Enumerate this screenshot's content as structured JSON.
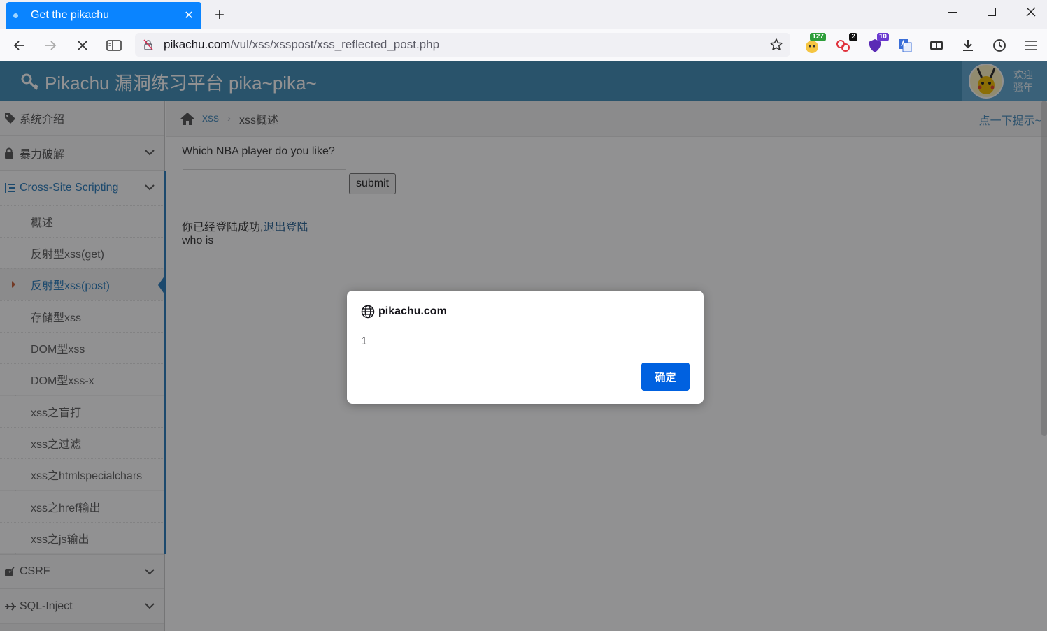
{
  "browser": {
    "tab_title": "Get the pikachu",
    "tab_close": "✕",
    "new_tab": "+",
    "url_host": "pikachu.com",
    "url_path": "/vul/xss/xsspost/xss_reflected_post.php",
    "extension_badges": [
      "127",
      "2",
      "10"
    ]
  },
  "site": {
    "brand": "Pikachu 漏洞练习平台 pika~pika~",
    "welcome_line1": "欢迎",
    "welcome_line2": "骚年"
  },
  "sidebar": {
    "top_items": [
      {
        "label": "系统介绍"
      },
      {
        "label": "暴力破解"
      },
      {
        "label": "Cross-Site Scripting"
      }
    ],
    "sub_items": [
      {
        "label": "概述"
      },
      {
        "label": "反射型xss(get)"
      },
      {
        "label": "反射型xss(post)"
      },
      {
        "label": "存储型xss"
      },
      {
        "label": "DOM型xss"
      },
      {
        "label": "DOM型xss-x"
      },
      {
        "label": "xss之盲打"
      },
      {
        "label": "xss之过滤"
      },
      {
        "label": "xss之htmlspecialchars"
      },
      {
        "label": "xss之href输出"
      },
      {
        "label": "xss之js输出"
      }
    ],
    "bottom_items": [
      {
        "label": "CSRF"
      },
      {
        "label": "SQL-Inject"
      }
    ]
  },
  "breadcrumb": {
    "link": "xss",
    "separator": "›",
    "current": "xss概述",
    "hint": "点一下提示~"
  },
  "content": {
    "question": "Which NBA player do you like?",
    "input_value": "",
    "submit_label": "submit",
    "login_text": "你已经登陆成功,",
    "logout_link": "退出登陆",
    "whois": "who is"
  },
  "dialog": {
    "origin": "pikachu.com",
    "message": "1",
    "ok_label": "确定"
  },
  "colors": {
    "header": "#438eb9",
    "accent": "#2b7dbc",
    "dialog_button": "#0061e0",
    "tab_active": "#0a84ff"
  }
}
